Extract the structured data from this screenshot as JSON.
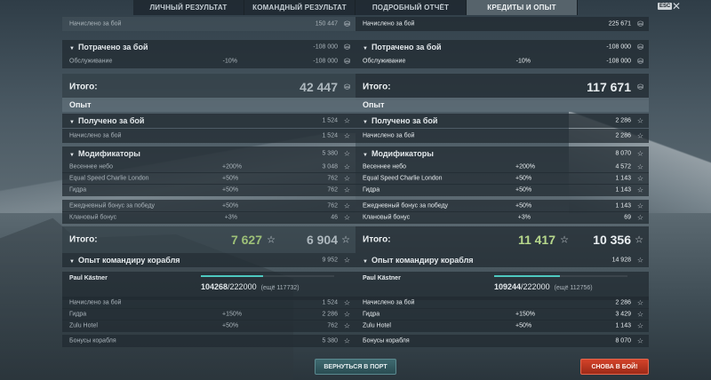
{
  "tabs": [
    {
      "label": "ЛИЧНЫЙ РЕЗУЛЬТАТ"
    },
    {
      "label": "КОМАНДНЫЙ РЕЗУЛЬТАТ"
    },
    {
      "label": "ПОДРОБНЫЙ ОТЧЁТ"
    },
    {
      "label": "КРЕДИТЫ И ОПЫТ"
    }
  ],
  "esc_label": "ESC",
  "left": {
    "credits_earned": {
      "label": "Начислено за бой",
      "value": "150 447"
    },
    "credits_spent": {
      "label": "Потрачено за бой",
      "value": "-108 000"
    },
    "maintenance": {
      "label": "Обслуживание",
      "pct": "-10%",
      "value": "-108 000"
    },
    "credits_total": {
      "label": "Итого:",
      "value": "42 447"
    },
    "xp_section": "Опыт",
    "xp_received": {
      "label": "Получено за бой",
      "value": "1 524"
    },
    "xp_earned": {
      "label": "Начислено за бой",
      "value": "1 524"
    },
    "modifiers": {
      "label": "Модификаторы",
      "value": "5 380"
    },
    "mod_rows": [
      {
        "label": "Весеннее небо",
        "pct": "+200%",
        "value": "3 048"
      },
      {
        "label": "Equal Speed Charlie London",
        "pct": "+50%",
        "value": "762"
      },
      {
        "label": "Гидра",
        "pct": "+50%",
        "value": "762"
      },
      {
        "label": "Ежедневный бонус за победу",
        "pct": "+50%",
        "value": "762"
      },
      {
        "label": "Клановый бонус",
        "pct": "+3%",
        "value": "46"
      }
    ],
    "xp_total": {
      "label": "Итого:",
      "premium": "7 627",
      "value": "6 904"
    },
    "cmdr_xp": {
      "label": "Опыт командиру корабля",
      "value": "9 952"
    },
    "commander": {
      "name": "Paul Kästner",
      "current": "104268",
      "max": "/222000",
      "rest": "(ещё 117732)"
    },
    "cmdr_rows": [
      {
        "label": "Начислено за бой",
        "pct": "",
        "value": "1 524"
      },
      {
        "label": "Гидра",
        "pct": "+150%",
        "value": "2 286"
      },
      {
        "label": "Zulu Hotel",
        "pct": "+50%",
        "value": "762"
      }
    ],
    "ship_bonus": {
      "label": "Бонусы корабля",
      "value": "5 380"
    }
  },
  "right": {
    "credits_earned": {
      "label": "Начислено за бой",
      "value": "225 671"
    },
    "credits_spent": {
      "label": "Потрачено за бой",
      "value": "-108 000"
    },
    "maintenance": {
      "label": "Обслуживание",
      "pct": "-10%",
      "value": "-108 000"
    },
    "credits_total": {
      "label": "Итого:",
      "value": "117 671"
    },
    "xp_section": "Опыт",
    "xp_received": {
      "label": "Получено за бой",
      "value": "2 286"
    },
    "xp_earned": {
      "label": "Начислено за бой",
      "value": "2 286"
    },
    "modifiers": {
      "label": "Модификаторы",
      "value": "8 070"
    },
    "mod_rows": [
      {
        "label": "Весеннее небо",
        "pct": "+200%",
        "value": "4 572"
      },
      {
        "label": "Equal Speed Charlie London",
        "pct": "+50%",
        "value": "1 143"
      },
      {
        "label": "Гидра",
        "pct": "+50%",
        "value": "1 143"
      },
      {
        "label": "Ежедневный бонус за победу",
        "pct": "+50%",
        "value": "1 143"
      },
      {
        "label": "Клановый бонус",
        "pct": "+3%",
        "value": "69"
      }
    ],
    "xp_total": {
      "label": "Итого:",
      "premium": "11 417",
      "value": "10 356"
    },
    "cmdr_xp": {
      "label": "Опыт командиру корабля",
      "value": "14 928"
    },
    "commander": {
      "name": "Paul Kästner",
      "current": "109244",
      "max": "/222000",
      "rest": "(ещё 112756)"
    },
    "cmdr_rows": [
      {
        "label": "Начислено за бой",
        "pct": "",
        "value": "2 286"
      },
      {
        "label": "Гидра",
        "pct": "+150%",
        "value": "3 429"
      },
      {
        "label": "Zulu Hotel",
        "pct": "+50%",
        "value": "1 143"
      }
    ],
    "ship_bonus": {
      "label": "Бонусы корабля",
      "value": "8 070"
    }
  },
  "buttons": {
    "port": "ВЕРНУТЬСЯ В ПОРТ",
    "battle": "СНОВА В БОЙ!"
  },
  "icons": {
    "credit": "coin-icon",
    "xp": "star-icon",
    "collapse": "triangle-down-icon"
  },
  "colors": {
    "premium_xp": "#b7d88c",
    "battle_button": "#d4432a",
    "port_button": "#3f6a70",
    "cmdr_bar": "#4ec9c0"
  }
}
